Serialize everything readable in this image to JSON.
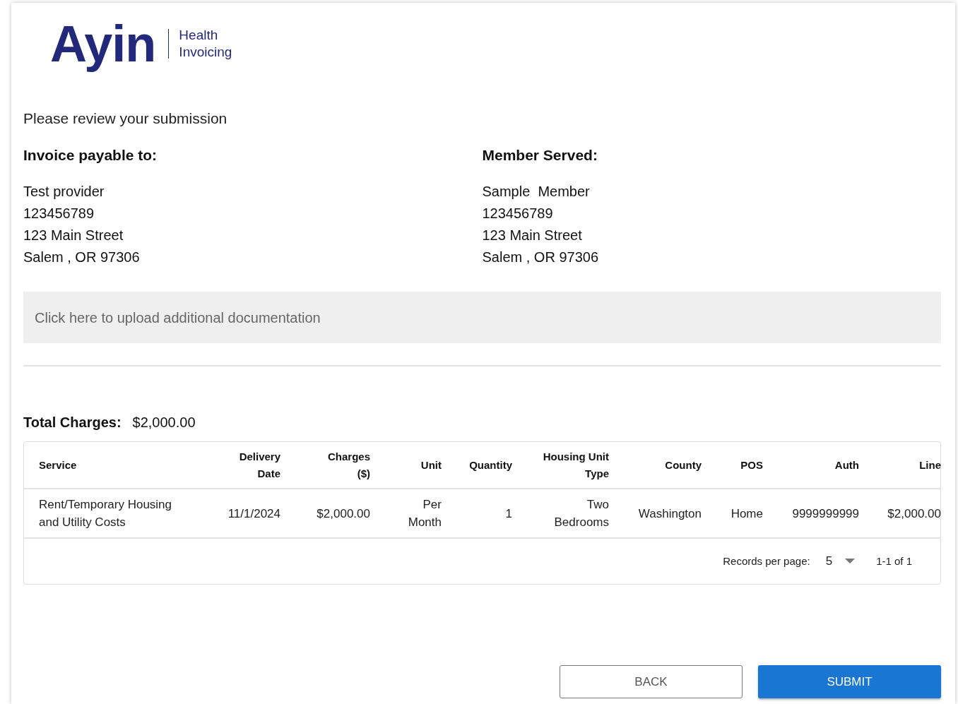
{
  "logo": {
    "wordmark": "Ayin",
    "tagline_1": "Health",
    "tagline_2": "Invoicing"
  },
  "heading": "Please review your submission",
  "payable_to": {
    "title": "Invoice payable to:",
    "lines": [
      "Test provider",
      "123456789",
      "123 Main Street",
      "Salem , OR 97306"
    ]
  },
  "member_served": {
    "title": "Member Served:",
    "lines": [
      "Sample  Member",
      "123456789",
      "123 Main Street",
      "Salem , OR 97306"
    ]
  },
  "upload": {
    "label": "Click here to upload additional documentation"
  },
  "total": {
    "label": "Total Charges:",
    "value": "$2,000.00"
  },
  "table": {
    "columns": [
      "Service",
      "Delivery Date",
      "Charges ($)",
      "Unit",
      "Quantity",
      "Housing Unit Type",
      "County",
      "POS",
      "Auth",
      "Line"
    ],
    "rows": [
      [
        "Rent/Temporary Housing and Utility Costs",
        "11/1/2024",
        "$2,000.00",
        "Per Month",
        "1",
        "Two Bedrooms",
        "Washington",
        "Home",
        "9999999999",
        "$2,000.00"
      ]
    ],
    "records_per_page_label": "Records per page:",
    "records_per_page": "5",
    "range": "1-1 of 1"
  },
  "buttons": [
    {
      "kind": "outline",
      "label": "BACK"
    },
    {
      "kind": "primary",
      "label": "SUBMIT"
    }
  ]
}
